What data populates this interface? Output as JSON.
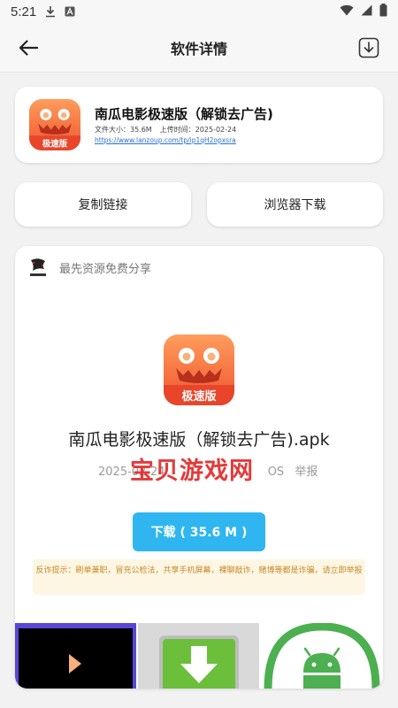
{
  "status_bar": {
    "time": "5:21"
  },
  "app_bar": {
    "title": "软件详情"
  },
  "app": {
    "name": "南瓜电影极速版（解锁去广告)",
    "size_label": "文件大小：35.6M",
    "upload_label": "上传时间：2025-02-24",
    "link": "https://www.lanzoup.com/tp/ip1qH2opxsra",
    "icon_badge": "极速版"
  },
  "actions": {
    "copy_link": "复制链接",
    "browser_download": "浏览器下载"
  },
  "share": {
    "brand_text": "最先资源免费分享",
    "file_name": "南瓜电影极速版（解锁去广告).apk",
    "file_meta": "2025-02-24",
    "file_meta_partial": "OS",
    "report_label": "举报",
    "watermark": "宝贝游戏网",
    "download_label": "下载 ( 35.6 M )",
    "warning": "反诈提示：刷单兼职，冒充公检法，共享手机屏幕，裸聊敲诈，赌博等都是诈骗，请立即举报"
  },
  "colors": {
    "accent": "#2fb6f0",
    "warning_text": "#c7892b",
    "watermark": "#e23030"
  }
}
